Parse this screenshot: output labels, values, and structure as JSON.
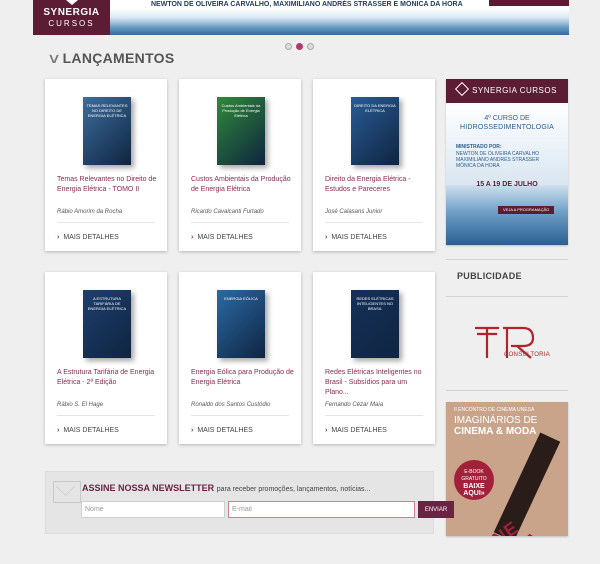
{
  "banner": {
    "logo_line1": "SYNERGIA",
    "logo_line2": "CURSOS",
    "instructors": "NEWTON DE OLIVEIRA CARVALHO, MAXIMILIANO ANDRÉS STRASSER E MÔNICA DA HORA",
    "slider_dots": 3,
    "active_dot": 2
  },
  "section": {
    "title": "LANÇAMENTOS"
  },
  "products": [
    {
      "title": "Temas Relevantes no Direito de Energia Elétrica - TOMO II",
      "author": "Rábio Amorim da Rocha",
      "more": "MAIS DETALHES",
      "cover_color": "#3d6e9c",
      "cover_text": "TEMAS RELEVANTES NO DIREITO DE ENERGIA ELÉTRICA"
    },
    {
      "title": "Custos Ambientais da Produção de Energia Elétrica",
      "author": "Ricardo Cavalcanti Furtado",
      "more": "MAIS DETALHES",
      "cover_color": "#2f8a3a",
      "cover_text": "Custos Ambientais da Produção de Energia Elétrica"
    },
    {
      "title": "Direito da Energia Elétrica - Estudos e Pareceres",
      "author": "José Calasans Junior",
      "more": "MAIS DETALHES",
      "cover_color": "#2a5c96",
      "cover_text": "DIREITO DA ENERGIA ELÉTRICA"
    },
    {
      "title": "A Estrutura Tarifária de Energia Elétrica - 2ª Edição",
      "author": "Rábio S. El Hage",
      "more": "MAIS DETALHES",
      "cover_color": "#1e3f6d",
      "cover_text": "A ESTRUTURA TARIFÁRIA DE ENERGIA ELÉTRICA"
    },
    {
      "title": "Energia Eólica para Produção de Energia Elétrica",
      "author": "Ronaldo dos Santos Custódio",
      "more": "MAIS DETALHES",
      "cover_color": "#2b6aa6",
      "cover_text": "ENERGIA EÓLICA"
    },
    {
      "title": "Redes Elétricas Inteligentes no Brasil - Subsídios para um Plano...",
      "author": "Fernando Cézar Maia",
      "more": "MAIS DETALHES",
      "cover_color": "#15315a",
      "cover_text": "REDES ELÉTRICAS INTELIGENTES NO BRASIL"
    }
  ],
  "course_ad": {
    "brand": "SYNERGIA CURSOS",
    "edition": "4º CURSO DE",
    "name": "HIDROSSEDIMENTOLOGIA",
    "by_label": "MINISTRADO POR:",
    "instructors": "NEWTON DE OLIVEIRA CARVALHO MAXIMILIANO ANDRÉS STRASSER MÔNICA DA HORA",
    "dates": "15 A 19 DE JULHO",
    "cta": "VEJA A PROGRAMAÇÃO"
  },
  "sidebar": {
    "ads_title": "PUBLICIDADE",
    "partner_name": "CONSULTORIA",
    "partner_color": "#b2242c"
  },
  "cinema_ad": {
    "event": "II ENCONTRO DE CINEMA UNESA",
    "title_line1": "IMAGINÁRIOS DE",
    "title_line2": "CINEMA & MODA",
    "badge_line1": "E-BOOK",
    "badge_line2": "GRATUITO",
    "badge_cta": "BAIXE AQUI»",
    "art_text": "CINE MODA"
  },
  "newsletter": {
    "title": "ASSINE NOSSA NEWSLETTER",
    "subtitle": "para receber promoções, lançamentos, notícias...",
    "name_placeholder": "Nome",
    "email_placeholder": "E-mail",
    "submit": "ENVIAR"
  },
  "colors": {
    "brand": "#5c1c33",
    "accent": "#8a2a4f",
    "background": "#efefef"
  }
}
